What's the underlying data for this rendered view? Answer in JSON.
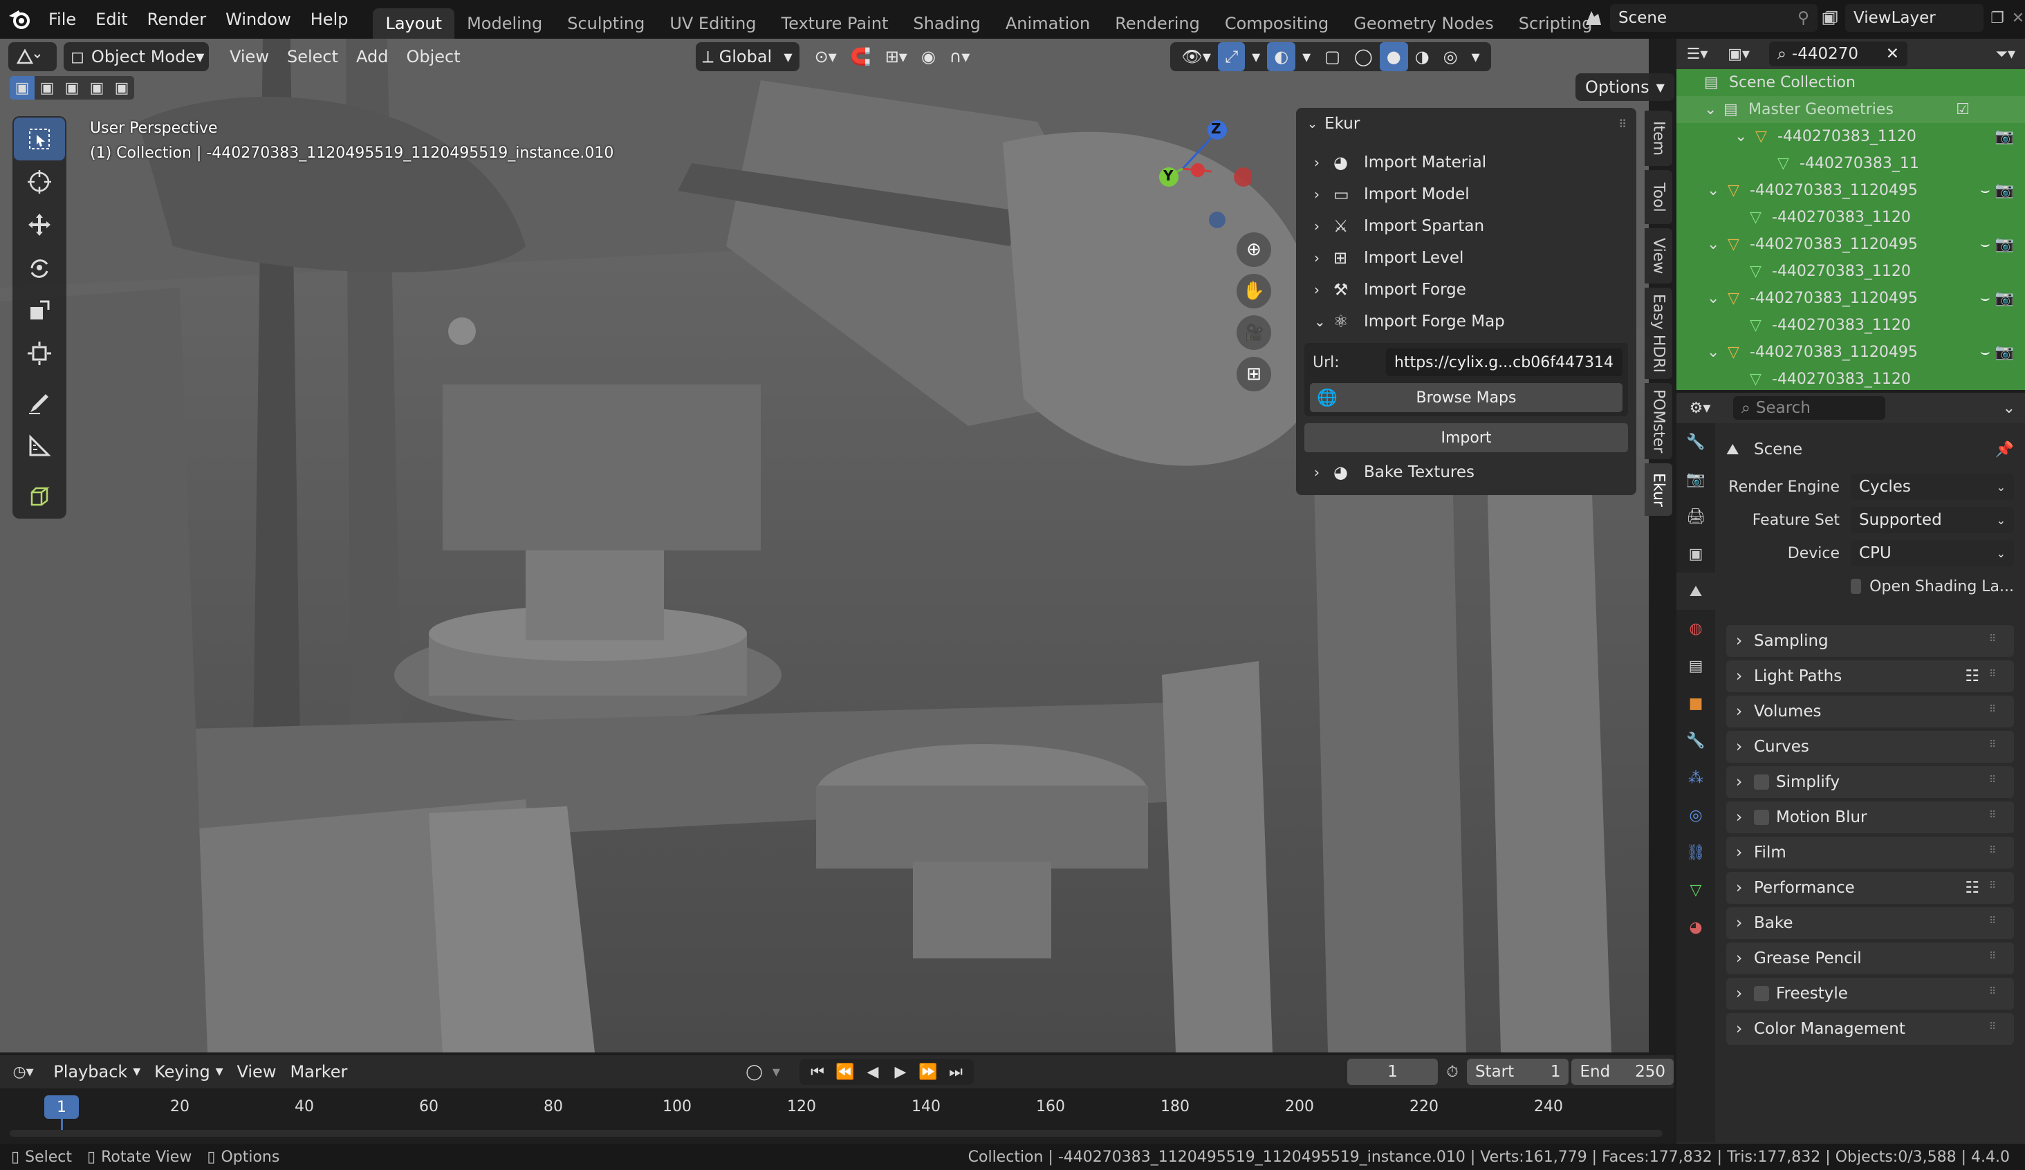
{
  "topbar": {
    "menus": [
      "File",
      "Edit",
      "Render",
      "Window",
      "Help"
    ],
    "workspaces": [
      "Layout",
      "Modeling",
      "Sculpting",
      "UV Editing",
      "Texture Paint",
      "Shading",
      "Animation",
      "Rendering",
      "Compositing",
      "Geometry Nodes",
      "Scripting"
    ],
    "active_workspace": "Layout",
    "add_tab": "+",
    "scene_name": "Scene",
    "view_layer": "ViewLayer"
  },
  "viewport_header": {
    "mode": "Object Mode",
    "menus": [
      "View",
      "Select",
      "Add",
      "Object"
    ],
    "orientation": "Global",
    "options_label": "Options"
  },
  "viewport": {
    "perspective_label": "User Perspective",
    "collection_label": "(1) Collection | -440270383_1120495519_1120495519_instance.010",
    "gizmo_axes": {
      "z": "Z",
      "y": "Y"
    }
  },
  "n_panel_tabs": [
    "Item",
    "Tool",
    "View",
    "Easy HDRI",
    "POMster",
    "Ekur"
  ],
  "ekur_panel": {
    "title": "Ekur",
    "items": [
      {
        "label": "Import Material",
        "icon": "material-icon",
        "expanded": false
      },
      {
        "label": "Import Model",
        "icon": "model-icon",
        "expanded": false
      },
      {
        "label": "Import Spartan",
        "icon": "spartan-icon",
        "expanded": false
      },
      {
        "label": "Import Level",
        "icon": "level-icon",
        "expanded": false
      },
      {
        "label": "Import Forge",
        "icon": "forge-icon",
        "expanded": false
      },
      {
        "label": "Import Forge Map",
        "icon": "forge-map-icon",
        "expanded": true
      }
    ],
    "url_label": "Url:",
    "url_value": "https://cylix.g...cb06f447314",
    "browse_button": "Browse Maps",
    "import_button": "Import",
    "bake_label": "Bake Textures"
  },
  "outliner": {
    "search_value": "-440270",
    "rows": [
      {
        "label": "Scene Collection",
        "indent": 0
      },
      {
        "label": "Master Geometries",
        "indent": 1
      },
      {
        "label": "-440270383_1120",
        "indent": 2
      },
      {
        "label": "-440270383_11",
        "indent": 3
      },
      {
        "label": "-440270383_1120495",
        "indent": 1
      },
      {
        "label": "-440270383_1120",
        "indent": 2
      },
      {
        "label": "-440270383_1120495",
        "indent": 1
      },
      {
        "label": "-440270383_1120",
        "indent": 2
      },
      {
        "label": "-440270383_1120495",
        "indent": 1
      },
      {
        "label": "-440270383_1120",
        "indent": 2
      },
      {
        "label": "-440270383_1120495",
        "indent": 1
      },
      {
        "label": "-440270383_1120",
        "indent": 2
      }
    ]
  },
  "properties": {
    "search_placeholder": "Search",
    "context_title": "Scene",
    "render_engine_label": "Render Engine",
    "render_engine_value": "Cycles",
    "feature_set_label": "Feature Set",
    "feature_set_value": "Supported",
    "device_label": "Device",
    "device_value": "CPU",
    "open_shading_label": "Open Shading La...",
    "sections": [
      {
        "label": "Sampling",
        "checkbox": false,
        "list_icon": false
      },
      {
        "label": "Light Paths",
        "checkbox": false,
        "list_icon": true
      },
      {
        "label": "Volumes",
        "checkbox": false,
        "list_icon": false
      },
      {
        "label": "Curves",
        "checkbox": false,
        "list_icon": false
      },
      {
        "label": "Simplify",
        "checkbox": true,
        "list_icon": false
      },
      {
        "label": "Motion Blur",
        "checkbox": true,
        "list_icon": false
      },
      {
        "label": "Film",
        "checkbox": false,
        "list_icon": false
      },
      {
        "label": "Performance",
        "checkbox": false,
        "list_icon": true
      },
      {
        "label": "Bake",
        "checkbox": false,
        "list_icon": false
      },
      {
        "label": "Grease Pencil",
        "checkbox": false,
        "list_icon": false
      },
      {
        "label": "Freestyle",
        "checkbox": true,
        "list_icon": false
      },
      {
        "label": "Color Management",
        "checkbox": false,
        "list_icon": false
      }
    ]
  },
  "timeline": {
    "menus": [
      "Playback",
      "Keying",
      "View",
      "Marker"
    ],
    "current_frame": "1",
    "start_label": "Start",
    "start_value": "1",
    "end_label": "End",
    "end_value": "250",
    "ticks": [
      "1",
      "20",
      "40",
      "60",
      "80",
      "100",
      "120",
      "140",
      "160",
      "180",
      "200",
      "220",
      "240"
    ]
  },
  "statusbar": {
    "select": "Select",
    "rotate": "Rotate View",
    "options": "Options",
    "info": "Collection | -440270383_1120495519_1120495519_instance.010 | Verts:161,779 | Faces:177,832 | Tris:177,832 | Objects:0/3,588 | 4.4.0"
  },
  "colors": {
    "accent": "#4772b3",
    "outliner_bg": "#3f8f3c",
    "vertex_green": "#b5d96b"
  }
}
